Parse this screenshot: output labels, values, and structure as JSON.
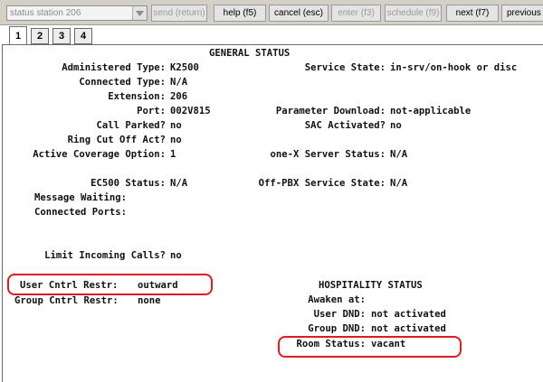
{
  "toolbar": {
    "command_value": "status station 206",
    "send": "send (return)",
    "help": "help (f5)",
    "cancel": "cancel (esc)",
    "enter": "enter (f3)",
    "schedule": "schedule (f9)",
    "next": "next (f7)",
    "previous": "previous"
  },
  "tabs": [
    "1",
    "2",
    "3",
    "4"
  ],
  "screen": {
    "heading": "GENERAL STATUS",
    "administered_type": {
      "label": "Administered Type:",
      "value": "K2500"
    },
    "connected_type": {
      "label": "Connected Type:",
      "value": "N/A"
    },
    "extension": {
      "label": "Extension:",
      "value": "206"
    },
    "port": {
      "label": "Port:",
      "value": "002V815"
    },
    "call_parked": {
      "label": "Call Parked?",
      "value": "no"
    },
    "ring_cut_off": {
      "label": "Ring Cut Off Act?",
      "value": "no"
    },
    "active_coverage": {
      "label": "Active Coverage Option:",
      "value": "1"
    },
    "ec500_status": {
      "label": "EC500 Status:",
      "value": "N/A"
    },
    "message_waiting": {
      "label": "Message Waiting:",
      "value": ""
    },
    "connected_ports": {
      "label": "Connected Ports:",
      "value": ""
    },
    "limit_incoming": {
      "label": "Limit Incoming Calls?",
      "value": "no"
    },
    "user_cntrl_restr": {
      "label": "User Cntrl Restr:",
      "value": "outward"
    },
    "group_cntrl_restr": {
      "label": "Group Cntrl Restr:",
      "value": "none"
    },
    "service_state": {
      "label": "Service State:",
      "value": "in-srv/on-hook or disc"
    },
    "parameter_download": {
      "label": "Parameter Download:",
      "value": "not-applicable"
    },
    "sac_activated": {
      "label": "SAC Activated?",
      "value": "no"
    },
    "onex_status": {
      "label": "one-X Server Status:",
      "value": "N/A"
    },
    "off_pbx_state": {
      "label": "Off-PBX Service State:",
      "value": "N/A"
    },
    "hospitality_heading": "HOSPITALITY STATUS",
    "awaken_at": {
      "label": "Awaken at:",
      "value": ""
    },
    "user_dnd": {
      "label": "User DND:",
      "value": "not activated"
    },
    "group_dnd": {
      "label": "Group DND:",
      "value": "not activated"
    },
    "room_status": {
      "label": "Room Status:",
      "value": "vacant"
    }
  },
  "colors": {
    "highlight": "#e01a22",
    "toolbar_bg": "#d4d0c8",
    "disabled_text": "#9a9a9a"
  },
  "icons": {
    "dropdown": "chevron-down-icon"
  }
}
